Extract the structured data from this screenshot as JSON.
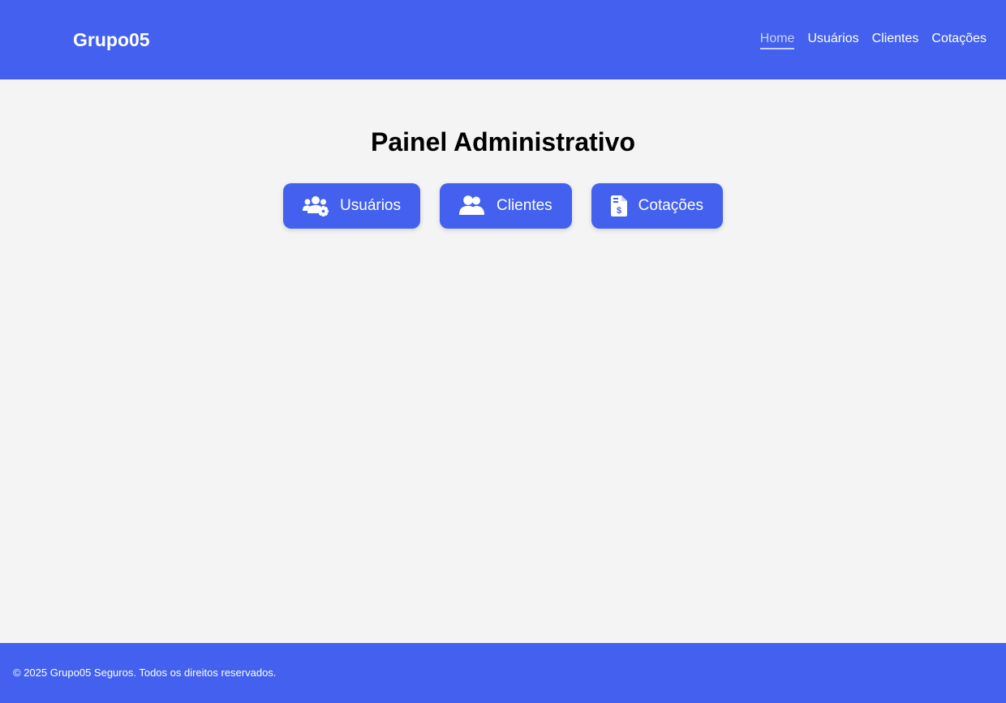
{
  "header": {
    "brand": "Grupo05",
    "nav": [
      "Home",
      "Usuários",
      "Clientes",
      "Cotações"
    ],
    "active_nav": "Home"
  },
  "main": {
    "title": "Painel Administrativo",
    "buttons": [
      {
        "label": "Usuários",
        "icon": "users-cog-icon"
      },
      {
        "label": "Clientes",
        "icon": "users-icon"
      },
      {
        "label": "Cotações",
        "icon": "invoice-dollar-icon"
      }
    ]
  },
  "footer": {
    "text": "© 2025 Grupo05 Seguros. Todos os direitos reservados."
  },
  "colors": {
    "primary": "#4361ee",
    "background": "#f4f4f5",
    "active_nav": "#c7d1f7"
  }
}
